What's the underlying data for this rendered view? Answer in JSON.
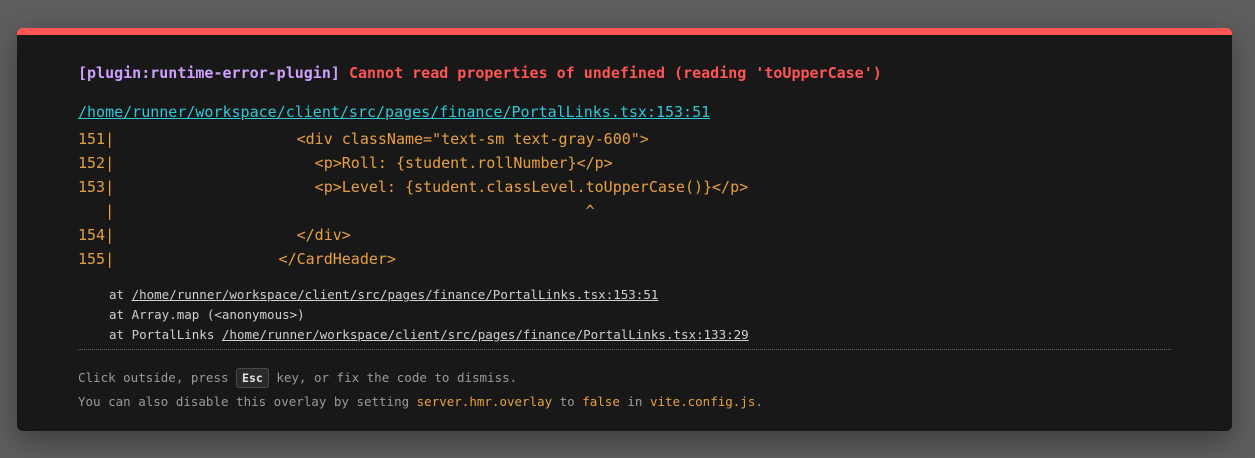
{
  "overlay": {
    "plugin": "[plugin:runtime-error-plugin]",
    "message": "Cannot read properties of undefined (reading 'toUpperCase')",
    "file": "/home/runner/workspace/client/src/pages/finance/PortalLinks.tsx:153:51",
    "frame": [
      {
        "num": "151|",
        "code": "                    <div className=\"text-sm text-gray-600\">"
      },
      {
        "num": "152|",
        "code": "                      <p>Roll: {student.rollNumber}</p>"
      },
      {
        "num": "153|",
        "code": "                      <p>Level: {student.classLevel.toUpperCase()}</p>"
      },
      {
        "num": "   |",
        "code": "                                                    ^"
      },
      {
        "num": "154|",
        "code": "                    </div>"
      },
      {
        "num": "155|",
        "code": "                  </CardHeader>"
      }
    ],
    "stack": [
      {
        "prefix": "at ",
        "link": "/home/runner/workspace/client/src/pages/finance/PortalLinks.tsx:153:51",
        "suffix": ""
      },
      {
        "prefix": "at Array.map (<anonymous>)",
        "link": "",
        "suffix": ""
      },
      {
        "prefix": "at PortalLinks ",
        "link": "/home/runner/workspace/client/src/pages/finance/PortalLinks.tsx:133:29",
        "suffix": ""
      }
    ],
    "tip1": {
      "before": "Click outside, press ",
      "key": "Esc",
      "after": " key, or fix the code to dismiss."
    },
    "tip2": {
      "t1": "You can also disable this overlay by setting ",
      "c1": "server.hmr.overlay",
      "t2": " to ",
      "c2": "false",
      "t3": " in ",
      "c3": "vite.config.js",
      "t4": "."
    },
    "colors": {
      "accent_bar": "#ff5555",
      "plugin": "#cfa0ff",
      "error": "#ff5555",
      "link": "#2ec8d8",
      "code": "#e8a040",
      "background": "#181818"
    }
  }
}
